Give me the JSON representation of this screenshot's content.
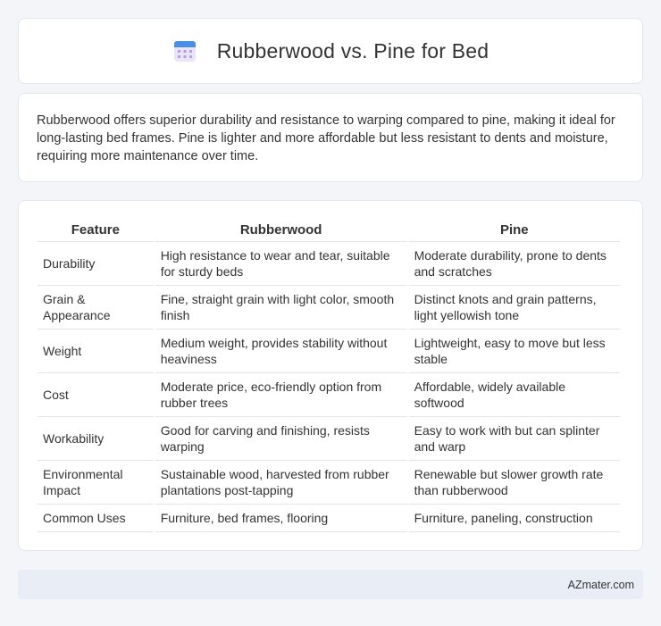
{
  "header": {
    "title": "Rubberwood vs. Pine for Bed",
    "icon": "calendar-icon"
  },
  "summary": {
    "text": "Rubberwood offers superior durability and resistance to warping compared to pine, making it ideal for long-lasting bed frames. Pine is lighter and more affordable but less resistant to dents and moisture, requiring more maintenance over time."
  },
  "table": {
    "headers": [
      "Feature",
      "Rubberwood",
      "Pine"
    ],
    "rows": [
      [
        "Durability",
        "High resistance to wear and tear, suitable for sturdy beds",
        "Moderate durability, prone to dents and scratches"
      ],
      [
        "Grain & Appearance",
        "Fine, straight grain with light color, smooth finish",
        "Distinct knots and grain patterns, light yellowish tone"
      ],
      [
        "Weight",
        "Medium weight, provides stability without heaviness",
        "Lightweight, easy to move but less stable"
      ],
      [
        "Cost",
        "Moderate price, eco-friendly option from rubber trees",
        "Affordable, widely available softwood"
      ],
      [
        "Workability",
        "Good for carving and finishing, resists warping",
        "Easy to work with but can splinter and warp"
      ],
      [
        "Environmental Impact",
        "Sustainable wood, harvested from rubber plantations post-tapping",
        "Renewable but slower growth rate than rubberwood"
      ],
      [
        "Common Uses",
        "Furniture, bed frames, flooring",
        "Furniture, paneling, construction"
      ]
    ]
  },
  "footer": {
    "brand": "AZmater.com"
  },
  "colors": {
    "background": "#f3f5f9",
    "card": "#ffffff",
    "footer": "#e8edf6",
    "icon_blue": "#4a90e2",
    "icon_purple": "#b39ddb"
  }
}
